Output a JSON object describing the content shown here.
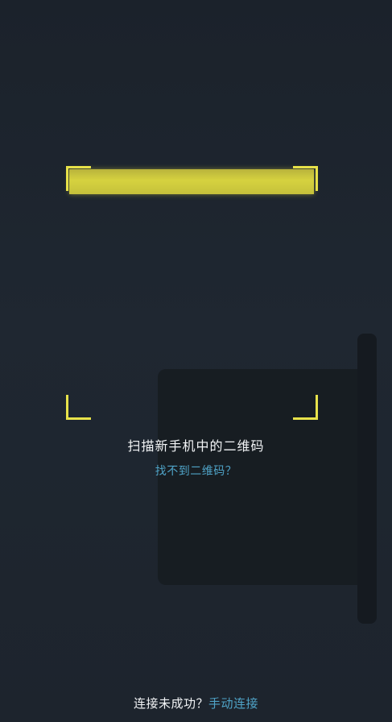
{
  "scanner": {
    "title": "扫描新手机中的二维码",
    "help_link": "找不到二维码？"
  },
  "footer": {
    "prompt": "连接未成功？",
    "manual_link": "手动连接"
  },
  "colors": {
    "frame": "#e7e24a",
    "link": "#4fa3c7",
    "background": "#1e252e"
  }
}
